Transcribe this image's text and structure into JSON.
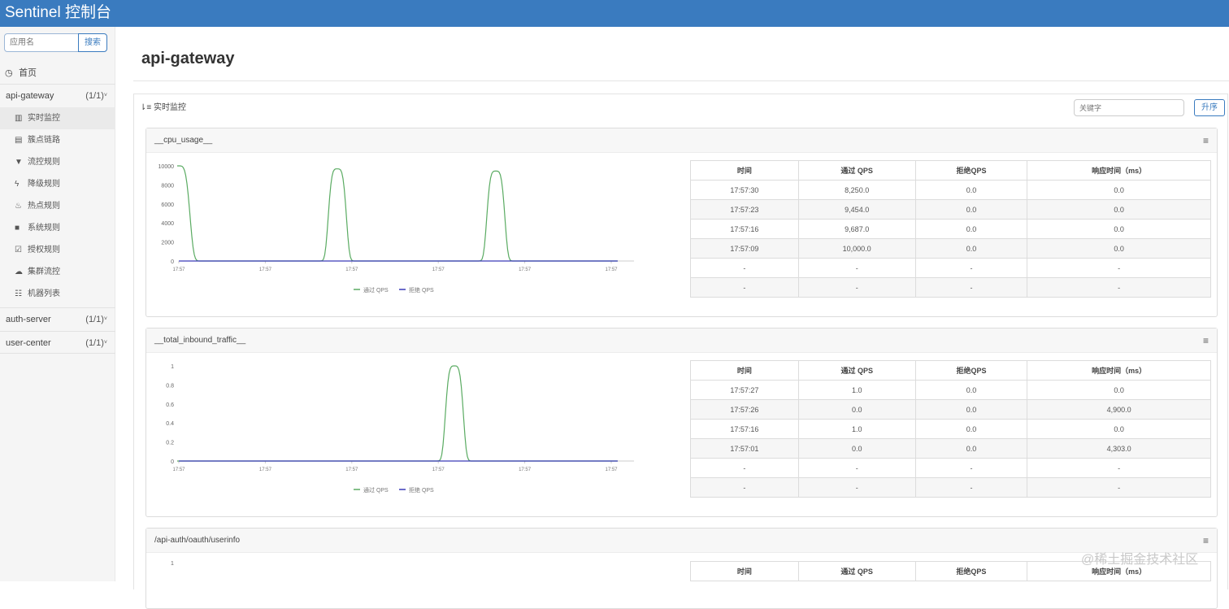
{
  "header": {
    "brand": "Sentinel 控制台"
  },
  "sidebar": {
    "search": {
      "placeholder": "应用名",
      "button": "搜索"
    },
    "home": "首页",
    "apps": [
      {
        "name": "api-gateway",
        "count": "(1/1)",
        "expanded": true
      },
      {
        "name": "auth-server",
        "count": "(1/1)",
        "expanded": false
      },
      {
        "name": "user-center",
        "count": "(1/1)",
        "expanded": false
      }
    ],
    "menu": [
      {
        "label": "实时监控",
        "icon": "bar-chart-icon"
      },
      {
        "label": "簇点链路",
        "icon": "list-icon"
      },
      {
        "label": "流控规则",
        "icon": "filter-icon"
      },
      {
        "label": "降级规则",
        "icon": "flash-icon"
      },
      {
        "label": "热点规则",
        "icon": "fire-icon"
      },
      {
        "label": "系统规则",
        "icon": "lock-icon"
      },
      {
        "label": "授权规则",
        "icon": "check-icon"
      },
      {
        "label": "集群流控",
        "icon": "cloud-icon"
      },
      {
        "label": "机器列表",
        "icon": "table-icon"
      }
    ]
  },
  "main": {
    "title": "api-gateway",
    "monitor_label": "实时监控",
    "keyword_placeholder": "关键字",
    "sort_button": "升序",
    "table_headers": [
      "时间",
      "通过 QPS",
      "拒绝QPS",
      "响应时间（ms）"
    ],
    "legend": [
      "通过 QPS",
      "拒绝 QPS"
    ],
    "colors": {
      "pass": "#5aab62",
      "block": "#3b3bb8",
      "accent": "#3a7bbf"
    },
    "resources": [
      {
        "name": "__cpu_usage__",
        "rows": [
          [
            "17:57:30",
            "8,250.0",
            "0.0",
            "0.0"
          ],
          [
            "17:57:23",
            "9,454.0",
            "0.0",
            "0.0"
          ],
          [
            "17:57:16",
            "9,687.0",
            "0.0",
            "0.0"
          ],
          [
            "17:57:09",
            "10,000.0",
            "0.0",
            "0.0"
          ],
          [
            "-",
            "-",
            "-",
            "-"
          ],
          [
            "-",
            "-",
            "-",
            "-"
          ]
        ]
      },
      {
        "name": "__total_inbound_traffic__",
        "rows": [
          [
            "17:57:27",
            "1.0",
            "0.0",
            "0.0"
          ],
          [
            "17:57:26",
            "0.0",
            "0.0",
            "4,900.0"
          ],
          [
            "17:57:16",
            "1.0",
            "0.0",
            "0.0"
          ],
          [
            "17:57:01",
            "0.0",
            "0.0",
            "4,303.0"
          ],
          [
            "-",
            "-",
            "-",
            "-"
          ],
          [
            "-",
            "-",
            "-",
            "-"
          ]
        ]
      },
      {
        "name": "/api-auth/oauth/userinfo",
        "rows": []
      }
    ]
  },
  "chart_data": [
    {
      "type": "line",
      "x": [
        "17:57",
        "17:57",
        "17:57",
        "17:57",
        "17:57",
        "17:57"
      ],
      "ylim": [
        0,
        10000
      ],
      "yticks": [
        "10000",
        "8000",
        "6000",
        "4000",
        "2000",
        "0"
      ],
      "series": [
        {
          "name": "通过 QPS",
          "peaks": [
            10000,
            9687,
            9454,
            8250
          ]
        },
        {
          "name": "拒绝 QPS",
          "values": [
            0,
            0,
            0,
            0,
            0,
            0
          ]
        }
      ],
      "grid": false,
      "legend": "bottom"
    },
    {
      "type": "line",
      "x": [
        "17:57",
        "17:57",
        "17:57",
        "17:57",
        "17:57",
        "17:57"
      ],
      "ylim": [
        0,
        1
      ],
      "yticks": [
        "1",
        "0.8",
        "0.6",
        "0.4",
        "0.2",
        "0"
      ],
      "series": [
        {
          "name": "通过 QPS",
          "peaks": [
            1,
            1
          ]
        },
        {
          "name": "拒绝 QPS",
          "values": [
            0,
            0,
            0,
            0,
            0,
            0
          ]
        }
      ],
      "grid": false,
      "legend": "bottom"
    },
    {
      "type": "line",
      "yticks": [
        "1"
      ]
    }
  ],
  "watermark": "@稀土掘金技术社区"
}
